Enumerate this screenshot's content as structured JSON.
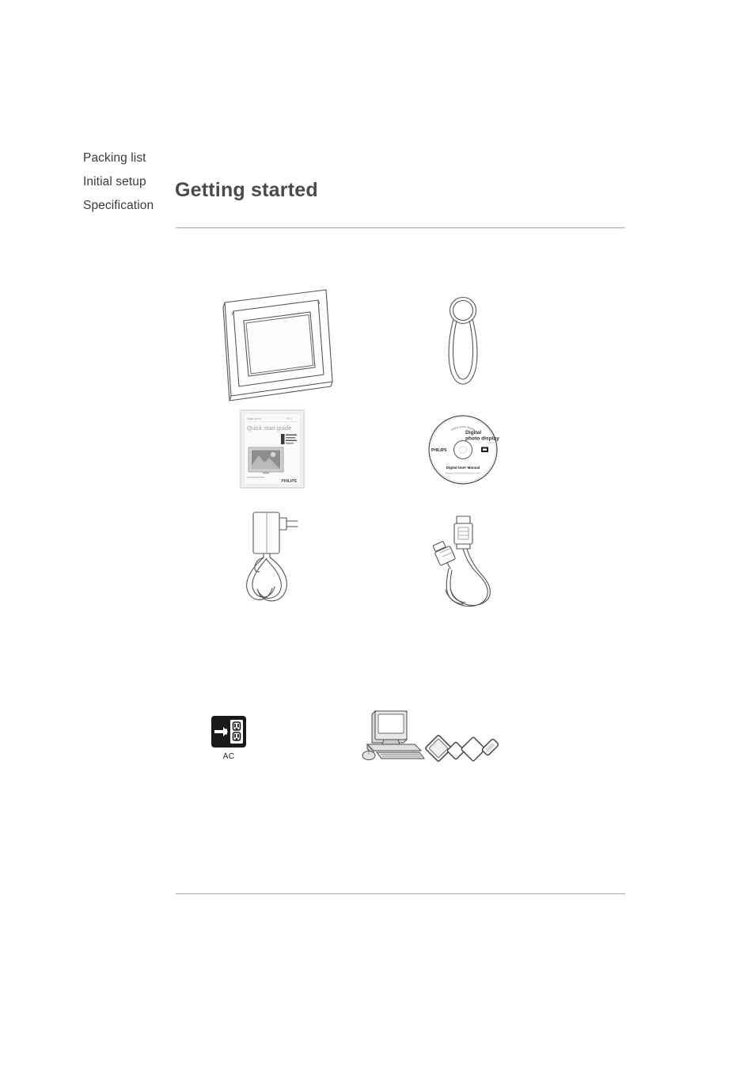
{
  "document": {
    "page_title": "Getting started"
  },
  "sidebar": {
    "items": [
      {
        "label": "Packing list"
      },
      {
        "label": "Initial setup"
      },
      {
        "label": "Specification"
      }
    ]
  },
  "packing_list": {
    "items": [
      {
        "name": "digital-photo-frame",
        "icon": "photo-frame-illustration"
      },
      {
        "name": "frame-stand",
        "icon": "stand-illustration"
      },
      {
        "name": "quick-start-guide",
        "icon": "booklet-illustration"
      },
      {
        "name": "user-manual-cd",
        "icon": "cd-disc-illustration"
      },
      {
        "name": "ac-power-adapter",
        "icon": "power-adapter-illustration"
      },
      {
        "name": "usb-cable",
        "icon": "usb-cable-illustration"
      }
    ]
  },
  "accessories": {
    "items": [
      {
        "name": "ac-outlet",
        "icon": "ac-outlet-icon",
        "label": "AC"
      },
      {
        "name": "computer",
        "icon": "desktop-computer-icon",
        "label": ""
      },
      {
        "name": "memory-cards",
        "icon": "memory-cards-icon",
        "label": ""
      }
    ]
  },
  "booklet": {
    "header_left": "Digital photo",
    "header_right": "7FF1",
    "title": "Quick start guide",
    "brand": "PHILIPS"
  },
  "cd": {
    "top_arc": "Digital photo display",
    "title_line1": "Digital",
    "title_line2": "photo display",
    "title_small": "7FF1",
    "brand": "PHILIPS",
    "subtitle": "Digital User Manual",
    "fineprint": "Requires Adobe Acrobat Reader to view"
  },
  "colors": {
    "page_background": "#ffffff",
    "heading": "#4a4a4a",
    "sidebar_text": "#3b3b3b",
    "rule": "#b8b8b8",
    "line_art": "#555555",
    "icon_black": "#1a1a1a"
  }
}
